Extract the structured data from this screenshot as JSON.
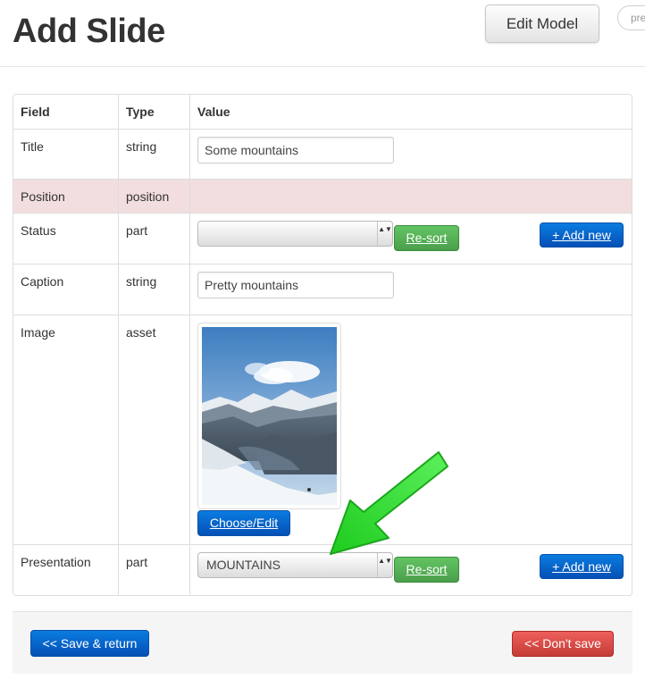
{
  "header": {
    "title": "Add Slide",
    "edit_model_label": "Edit Model",
    "preview_label": "pre"
  },
  "table": {
    "columns": [
      "Field",
      "Type",
      "Value"
    ],
    "rows": [
      {
        "field": "Title",
        "type": "string",
        "value": "Some mountains"
      },
      {
        "field": "Position",
        "type": "position",
        "value": ""
      },
      {
        "field": "Status",
        "type": "part",
        "value": ""
      },
      {
        "field": "Caption",
        "type": "string",
        "value": "Pretty mountains"
      },
      {
        "field": "Image",
        "type": "asset",
        "value": ""
      },
      {
        "field": "Presentation",
        "type": "part",
        "value": "MOUNTAINS"
      }
    ],
    "resort_label": "Re-sort",
    "add_new_label": "+ Add new",
    "choose_edit_label": "Choose/Edit",
    "select_arrows": "▲▼"
  },
  "footer": {
    "save_label": "<< Save & return",
    "dont_save_label": "<< Don't save"
  },
  "colors": {
    "primary": "#0a6ad6",
    "success": "#5bb75b",
    "danger": "#da4f49",
    "error_row": "#f2dede",
    "annotation": "#22dd22"
  },
  "icons": {
    "annotation": "arrow-pointer-icon",
    "image": "mountain-photo"
  }
}
